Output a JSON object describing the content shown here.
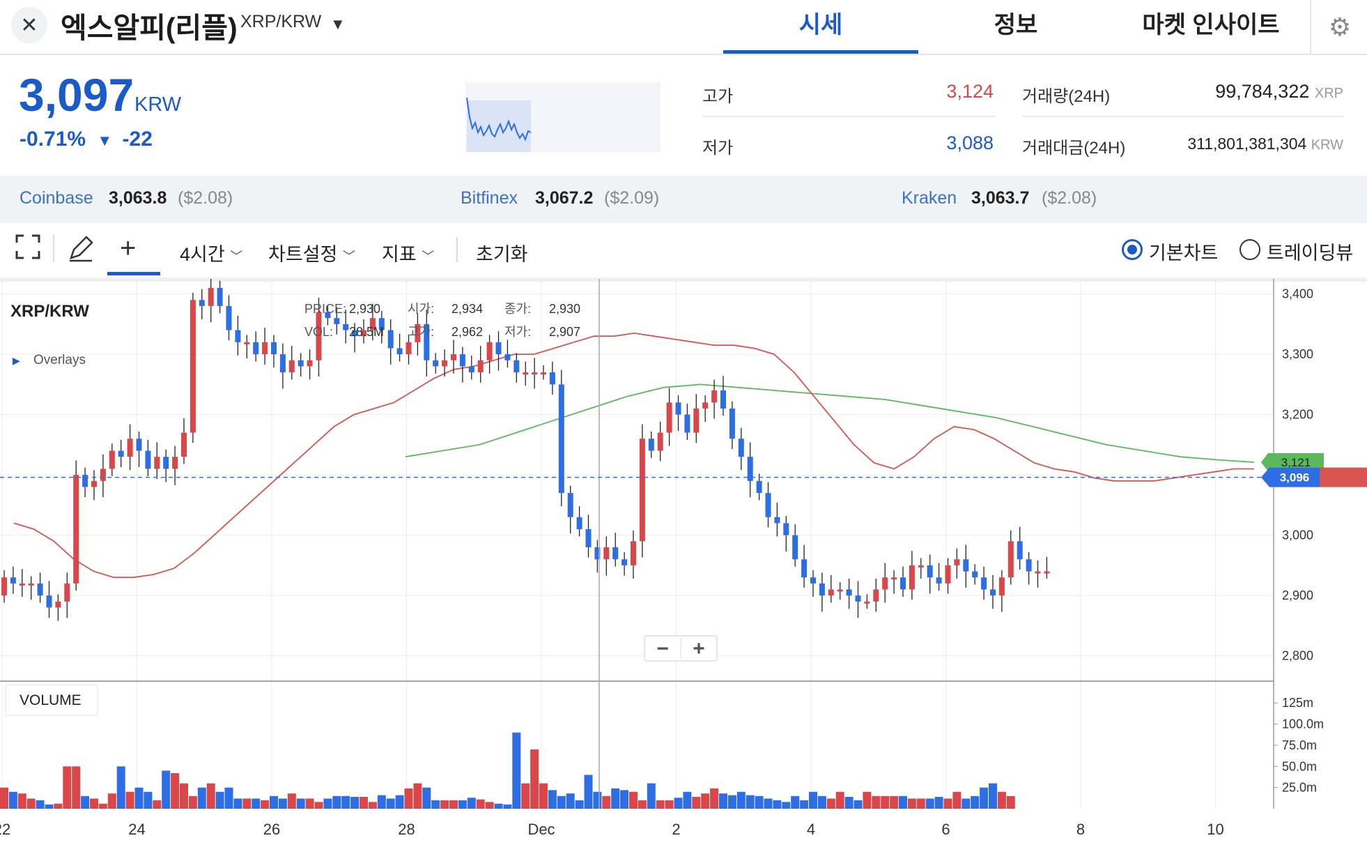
{
  "header": {
    "coin_name": "엑스알피(리플)",
    "pair": "XRP/KRW",
    "tabs": [
      {
        "label": "시세",
        "active": true
      },
      {
        "label": "정보",
        "active": false
      },
      {
        "label": "마켓 인사이트",
        "active": false
      }
    ]
  },
  "price": {
    "value": "3,097",
    "unit": "KRW",
    "change_pct": "-0.71%",
    "change_arrow": "▼",
    "change_abs": "-22"
  },
  "stats": {
    "high_label": "고가",
    "high_value": "3,124",
    "low_label": "저가",
    "low_value": "3,088",
    "volume_label": "거래량(24H)",
    "volume_value": "99,784,322",
    "volume_unit": "XRP",
    "amount_label": "거래대금(24H)",
    "amount_value": "311,801,381,304",
    "amount_unit": "KRW"
  },
  "exchanges": [
    {
      "name": "Coinbase",
      "price": "3,063.8",
      "usd": "($2.08)"
    },
    {
      "name": "Bitfinex",
      "price": "3,067.2",
      "usd": "($2.09)"
    },
    {
      "name": "Kraken",
      "price": "3,063.7",
      "usd": "($2.08)"
    }
  ],
  "toolbar": {
    "interval": "4시간",
    "chart_settings": "차트설정",
    "indicators": "지표",
    "reset": "초기화",
    "basic_chart": "기본차트",
    "trading_view": "트레이딩뷰"
  },
  "colors": {
    "accent": "#1b5ac9",
    "up": "#d9474a",
    "down": "#2e6ee5",
    "ma_fast": "#d9534f",
    "ma_slow": "#5cb85c"
  },
  "chart_data": {
    "type": "candlestick",
    "symbol": "XRP/KRW",
    "overlays_label": "Overlays",
    "tooltip": {
      "price_label": "PRICE:",
      "price": "2,930",
      "vol_label": "VOL:",
      "vol": "28.5M",
      "open_label": "시가:",
      "open": "2,934",
      "high_label": "고가:",
      "high": "2,962",
      "close_label": "종가:",
      "close": "2,930",
      "low_label": "저가:",
      "low": "2,907"
    },
    "y_ticks": [
      "3,400",
      "3,300",
      "3,200",
      "3,100",
      "3,000",
      "2,900",
      "2,800"
    ],
    "ylim": [
      2758,
      3425
    ],
    "x_ticks": [
      "22",
      "24",
      "26",
      "28",
      "Dec",
      "2",
      "4",
      "6",
      "8",
      "10"
    ],
    "current_price_label": "3,096",
    "ma_slow_label": "3,121",
    "volume_label": "VOLUME",
    "volume_ticks": [
      "125m",
      "100.0m",
      "75.0m",
      "50.0m",
      "25.0m"
    ],
    "ohlc_start": 2900,
    "ohlc_changes": [
      30,
      -10,
      0,
      0,
      -20,
      -20,
      10,
      30,
      180,
      -20,
      10,
      20,
      30,
      -10,
      30,
      -20,
      -30,
      20,
      -20,
      20,
      40,
      220,
      -10,
      30,
      -30,
      -40,
      -20,
      0,
      -20,
      20,
      -20,
      -30,
      20,
      -10,
      10,
      80,
      -10,
      -10,
      -10,
      -10,
      10,
      20,
      -20,
      -30,
      -10,
      20,
      30,
      -60,
      -10,
      10,
      10,
      -20,
      -10,
      20,
      30,
      -20,
      -10,
      -20,
      0,
      0,
      0,
      -20,
      -180,
      -40,
      -20,
      -30,
      -20,
      20,
      -20,
      -10,
      40,
      170,
      -20,
      30,
      50,
      -20,
      -30,
      40,
      10,
      20,
      -30,
      -50,
      -30,
      -40,
      -20,
      -40,
      -10,
      -20,
      -40,
      -30,
      -10,
      -20,
      10,
      0,
      -10,
      -10,
      0,
      20,
      20,
      0,
      -20,
      40,
      0,
      -20,
      -10,
      30,
      10,
      -20,
      -10,
      -20,
      -10,
      30,
      60,
      -30,
      -20,
      0,
      0
    ],
    "volume_values": [
      25,
      20,
      18,
      12,
      10,
      5,
      6,
      50,
      50,
      15,
      12,
      6,
      18,
      50,
      20,
      25,
      20,
      10,
      45,
      42,
      30,
      15,
      25,
      30,
      20,
      25,
      12,
      12,
      12,
      10,
      15,
      12,
      18,
      12,
      12,
      8,
      12,
      15,
      15,
      14,
      14,
      8,
      16,
      12,
      16,
      24,
      30,
      25,
      10,
      10,
      10,
      10,
      13,
      11,
      8,
      6,
      5,
      90,
      30,
      70,
      30,
      22,
      15,
      18,
      10,
      40,
      20,
      15,
      24,
      22,
      20,
      10,
      30,
      10,
      10,
      13,
      20,
      14,
      18,
      24,
      18,
      16,
      20,
      16,
      15,
      12,
      10,
      8,
      15,
      10,
      20,
      15,
      12,
      20,
      14,
      10,
      20,
      15,
      15,
      15,
      15,
      12,
      12,
      12,
      14,
      12,
      20,
      12,
      15,
      25,
      30,
      20,
      15
    ],
    "ma_fast": [
      3020,
      3010,
      2990,
      2960,
      2940,
      2930,
      2930,
      2935,
      2945,
      2970,
      3000,
      3030,
      3060,
      3090,
      3120,
      3150,
      3180,
      3200,
      3210,
      3220,
      3240,
      3260,
      3275,
      3280,
      3290,
      3300,
      3300,
      3310,
      3320,
      3330,
      3330,
      3335,
      3330,
      3325,
      3320,
      3315,
      3315,
      3310,
      3300,
      3270,
      3230,
      3190,
      3150,
      3120,
      3110,
      3130,
      3160,
      3180,
      3175,
      3160,
      3140,
      3120,
      3110,
      3105,
      3095,
      3090,
      3090,
      3090,
      3095,
      3100,
      3105,
      3110,
      3110
    ],
    "ma_slow": [
      3130,
      3140,
      3150,
      3170,
      3190,
      3210,
      3230,
      3245,
      3250,
      3245,
      3240,
      3235,
      3230,
      3225,
      3215,
      3205,
      3195,
      3180,
      3165,
      3150,
      3140,
      3130,
      3125,
      3121
    ]
  }
}
